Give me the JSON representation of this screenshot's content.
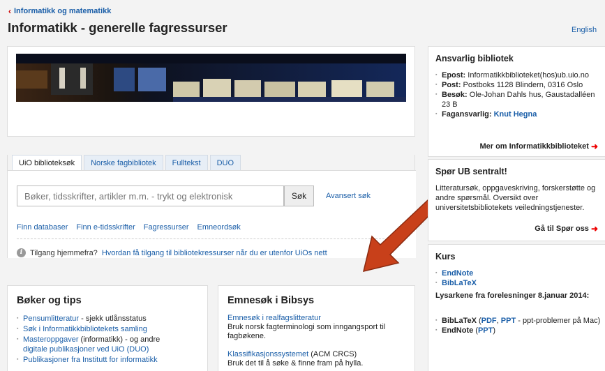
{
  "breadcrumb": {
    "label": "Informatikk og matematikk"
  },
  "page": {
    "title": "Informatikk - generelle fagressurser",
    "lang_link": "English"
  },
  "search": {
    "tabs": [
      "UiO biblioteksøk",
      "Norske fagbibliotek",
      "Fulltekst",
      "DUO"
    ],
    "placeholder": "Bøker, tidsskrifter, artikler m.m. - trykt og elektronisk",
    "button": "Søk",
    "advanced": "Avansert søk",
    "quick_links": [
      "Finn databaser",
      "Finn e-tidsskrifter",
      "Fagressurser",
      "Emneordsøk"
    ],
    "info_prefix": "Tilgang hjemmefra?",
    "info_link": "Hvordan få tilgang til bibliotekressurser når du er utenfor UiOs nett"
  },
  "books": {
    "title": "Bøker og tips",
    "item1_link": "Pensumlitteratur",
    "item1_rest": " - sjekk utlånsstatus",
    "item2_link": "Søk i Informatikkbibliotekets samling",
    "item3_link": "Masteroppgaver",
    "item3_rest": " (informatikk) - og andre",
    "item3_link2": "digitale publikasjoner ved UiO (DUO)",
    "item4_link": "Publikasjoner fra Institutt for informatikk"
  },
  "subjects": {
    "title": "Emnesøk i Bibsys",
    "b1_link": "Emnesøk i realfagslitteratur",
    "b1_text": "Bruk norsk fagterminologi som inngangsport til fagbøkene.",
    "b2_link": "Klassifikasjonssystemet",
    "b2_rest": " (ACM CRCS)",
    "b2_text": "Bruk det til å søke & finne fram på hylla."
  },
  "library": {
    "title": "Ansvarlig bibliotek",
    "email_label": "Epost:",
    "email_value": " Informatikkbiblioteket(hos)ub.uio.no",
    "post_label": "Post:",
    "post_value": " Postboks 1128 Blindern, 0316 Oslo",
    "visit_label": "Besøk:",
    "visit_value": " Ole-Johan Dahls hus, Gaustadalléen 23 B",
    "contact_label": "Fagansvarlig:",
    "contact_value": "Knut Hegna",
    "more": "Mer om Informatikkbiblioteket"
  },
  "ask": {
    "title": "Spør UB sentralt!",
    "text": "Litteratursøk, oppgaveskriving, forskerstøtte og andre spørsmål. Oversikt over universitetsbibliotekets veiledningstjenester.",
    "more": "Gå til Spør oss"
  },
  "courses": {
    "title": "Kurs",
    "item1": "EndNote",
    "item2": "BibLaTeX",
    "subheading": "Lysarkene fra forelesninger 8.januar 2014:",
    "s1_label": "BibLaTeX",
    "s1_pdf": "PDF",
    "s1_ppt": "PPT",
    "s1_rest": " - ppt-problemer på Mac)",
    "s2_label": "EndNote",
    "s2_ppt": "PPT"
  },
  "colors": {
    "link": "#1a5ea8",
    "accent_red": "#e00000",
    "arrow_red": "#c8401a"
  }
}
